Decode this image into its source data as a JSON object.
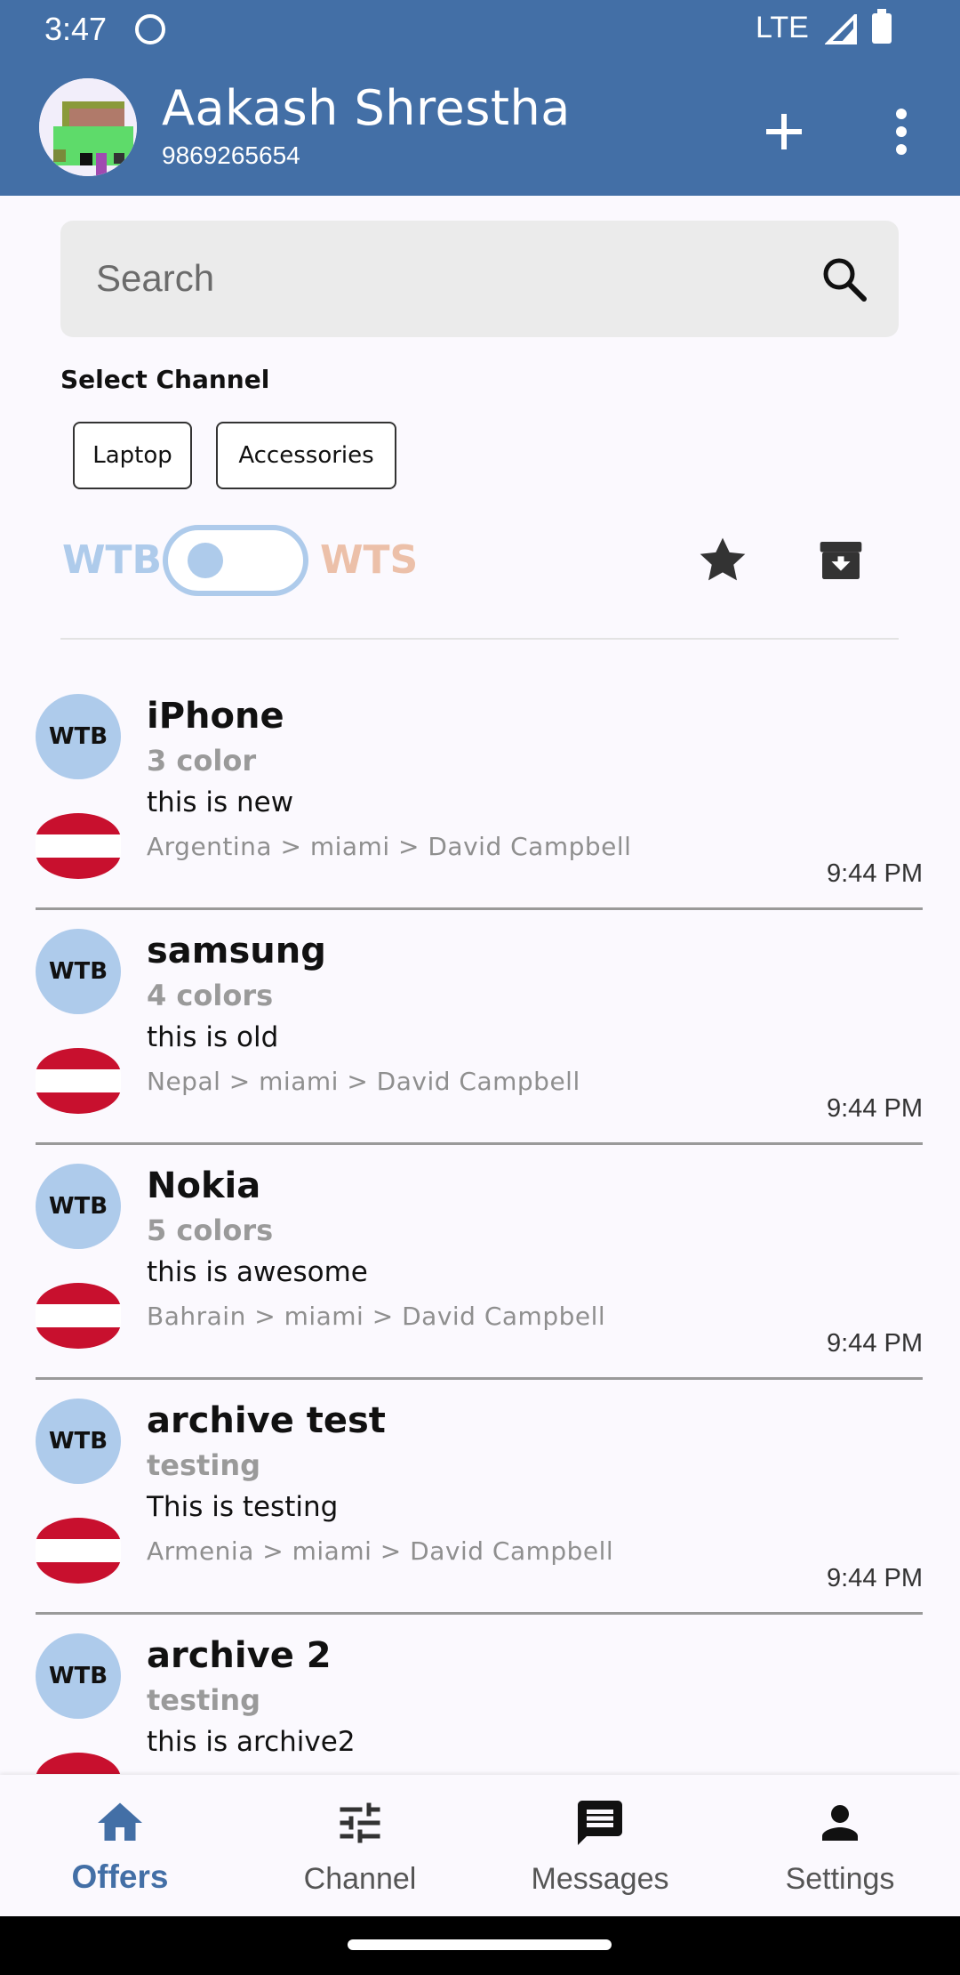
{
  "status_bar": {
    "time": "3:47",
    "network": "LTE"
  },
  "app_bar": {
    "name": "Aakash Shrestha",
    "phone": "9869265654"
  },
  "search": {
    "placeholder": "Search"
  },
  "channels": {
    "title": "Select Channel",
    "items": [
      "Laptop",
      "Accessories"
    ]
  },
  "filter": {
    "left_label": "WTB",
    "right_label": "WTS",
    "toggle_on": false
  },
  "offers": [
    {
      "badge": "WTB",
      "title": "iPhone",
      "subtitle": "3 color",
      "description": "this is new",
      "path": "Argentina > miami > David Campbell",
      "time": "9:44 PM"
    },
    {
      "badge": "WTB",
      "title": "samsung",
      "subtitle": "4 colors",
      "description": "this is old",
      "path": "Nepal > miami > David Campbell",
      "time": "9:44 PM"
    },
    {
      "badge": "WTB",
      "title": "Nokia",
      "subtitle": "5 colors",
      "description": "this is awesome",
      "path": "Bahrain > miami > David Campbell",
      "time": "9:44 PM"
    },
    {
      "badge": "WTB",
      "title": "archive test",
      "subtitle": "testing",
      "description": "This is testing",
      "path": "Armenia > miami > David Campbell",
      "time": "9:44 PM"
    },
    {
      "badge": "WTB",
      "title": "archive 2",
      "subtitle": "testing",
      "description": "this is archive2",
      "path": "",
      "time": ""
    }
  ],
  "bottom_nav": {
    "items": [
      {
        "label": "Offers",
        "icon": "home-icon",
        "active": true
      },
      {
        "label": "Channel",
        "icon": "tune-icon",
        "active": false
      },
      {
        "label": "Messages",
        "icon": "message-icon",
        "active": false
      },
      {
        "label": "Settings",
        "icon": "person-icon",
        "active": false
      }
    ]
  },
  "colors": {
    "primary": "#436fa6",
    "wtb": "#aecbeb",
    "wts": "#ecc0a9",
    "flag_red": "#c8102e"
  }
}
